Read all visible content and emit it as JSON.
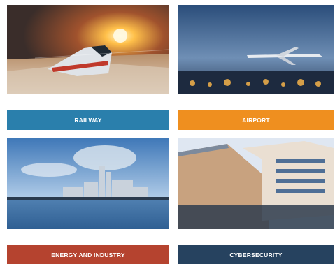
{
  "sectors": [
    {
      "key": "railway",
      "label": "RAILWAY",
      "color": "#2a7fac",
      "image": "high-speed-train-at-sunset-photo"
    },
    {
      "key": "airport",
      "label": "AIRPORT",
      "color": "#ef8f1f",
      "image": "airplane-over-city-lights-photo"
    },
    {
      "key": "energy",
      "label": "ENERGY AND INDUSTRY",
      "color": "#b5432f",
      "image": "industrial-plant-by-water-photo"
    },
    {
      "key": "cyber",
      "label": "CYBERSECURITY",
      "color": "#26425f",
      "image": "modern-office-building-photo"
    }
  ]
}
